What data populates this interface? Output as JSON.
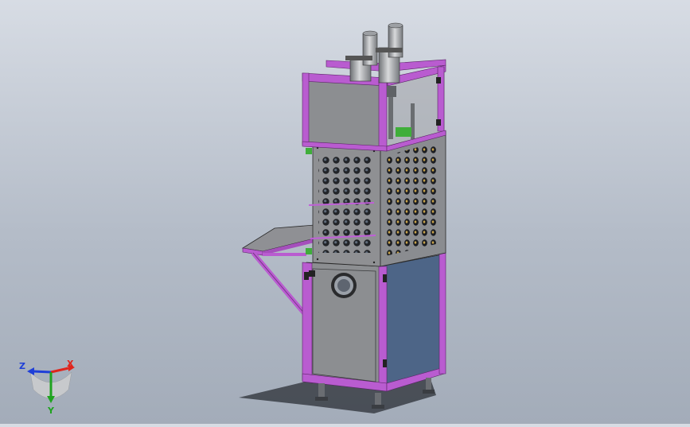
{
  "viewport": {
    "background_top": "#d7dce4",
    "background_bottom": "#a3acb9"
  },
  "model": {
    "frame_color": "#b95cd0",
    "panel_gray": "#8d8f92",
    "panel_blue": "#4d6587",
    "dark_edge": "#2a2a2a"
  },
  "triad": {
    "x_label": "X",
    "y_label": "Y",
    "z_label": "Z",
    "x_color": "#e0241c",
    "y_color": "#1fa31f",
    "z_color": "#1f3fd8"
  }
}
